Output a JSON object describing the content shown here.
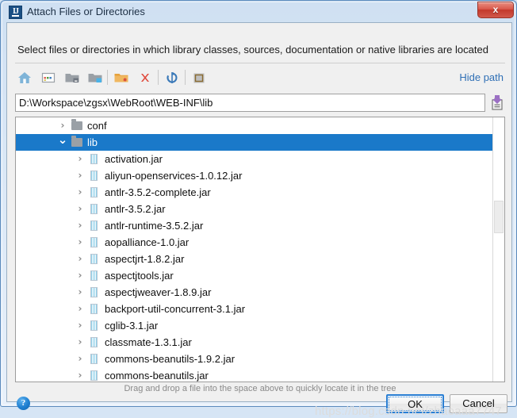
{
  "window": {
    "title": "Attach Files or Directories",
    "app_icon": "intellij-idea-icon",
    "close_label": "x"
  },
  "dialog": {
    "instruction": "Select files or directories in which library classes, sources, documentation or native libraries are located",
    "hint": "Drag and drop a file into the space above to quickly locate it in the tree",
    "hide_path_label": "Hide path",
    "help_label": "?",
    "ok_label": "OK",
    "cancel_label": "Cancel"
  },
  "toolbar": {
    "buttons": [
      {
        "name": "home-icon",
        "title": "Home"
      },
      {
        "name": "desktop-icon",
        "title": "Desktop"
      },
      {
        "name": "project-folder-icon",
        "title": "Project Directory"
      },
      {
        "name": "module-folder-icon",
        "title": "Module Directory"
      },
      {
        "name": "new-folder-icon",
        "title": "New Folder"
      },
      {
        "name": "delete-icon",
        "title": "Delete"
      },
      {
        "name": "refresh-icon",
        "title": "Refresh"
      },
      {
        "name": "show-hidden-icon",
        "title": "Show Hidden Files"
      }
    ]
  },
  "path": {
    "value": "D:\\Workspace\\zgsx\\WebRoot\\WEB-INF\\lib",
    "placeholder": "",
    "paste_icon": "paste-icon"
  },
  "tree": {
    "rows": [
      {
        "label": "conf",
        "type": "folder",
        "depth": 2,
        "expanded": false,
        "selected": false
      },
      {
        "label": "lib",
        "type": "folder",
        "depth": 2,
        "expanded": true,
        "selected": true
      },
      {
        "label": "activation.jar",
        "type": "jar",
        "depth": 3,
        "expanded": false,
        "selected": false
      },
      {
        "label": "aliyun-openservices-1.0.12.jar",
        "type": "jar",
        "depth": 3,
        "expanded": false,
        "selected": false
      },
      {
        "label": "antlr-3.5.2-complete.jar",
        "type": "jar",
        "depth": 3,
        "expanded": false,
        "selected": false
      },
      {
        "label": "antlr-3.5.2.jar",
        "type": "jar",
        "depth": 3,
        "expanded": false,
        "selected": false
      },
      {
        "label": "antlr-runtime-3.5.2.jar",
        "type": "jar",
        "depth": 3,
        "expanded": false,
        "selected": false
      },
      {
        "label": "aopalliance-1.0.jar",
        "type": "jar",
        "depth": 3,
        "expanded": false,
        "selected": false
      },
      {
        "label": "aspectjrt-1.8.2.jar",
        "type": "jar",
        "depth": 3,
        "expanded": false,
        "selected": false
      },
      {
        "label": "aspectjtools.jar",
        "type": "jar",
        "depth": 3,
        "expanded": false,
        "selected": false
      },
      {
        "label": "aspectjweaver-1.8.9.jar",
        "type": "jar",
        "depth": 3,
        "expanded": false,
        "selected": false
      },
      {
        "label": "backport-util-concurrent-3.1.jar",
        "type": "jar",
        "depth": 3,
        "expanded": false,
        "selected": false
      },
      {
        "label": "cglib-3.1.jar",
        "type": "jar",
        "depth": 3,
        "expanded": false,
        "selected": false
      },
      {
        "label": "classmate-1.3.1.jar",
        "type": "jar",
        "depth": 3,
        "expanded": false,
        "selected": false
      },
      {
        "label": "commons-beanutils-1.9.2.jar",
        "type": "jar",
        "depth": 3,
        "expanded": false,
        "selected": false
      },
      {
        "label": "commons-beanutils.jar",
        "type": "jar",
        "depth": 3,
        "expanded": false,
        "selected": false
      }
    ]
  },
  "watermark": {
    "text": "https://blog.csdn.net/zhaoaaa7747"
  },
  "colors": {
    "selection": "#1a79c9",
    "link": "#2f6fb5",
    "title_bar": "#cfe0f2",
    "close_button": "#c3392c"
  }
}
